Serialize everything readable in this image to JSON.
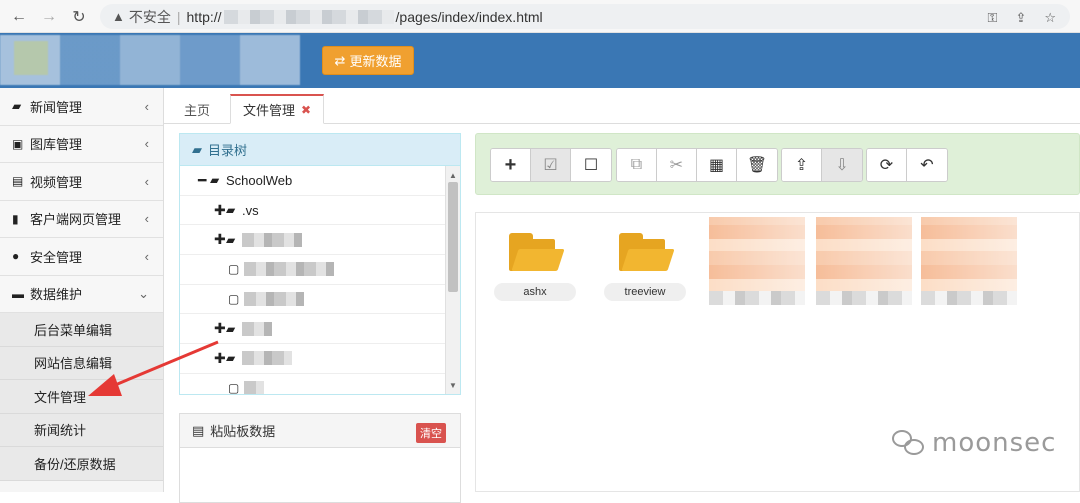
{
  "browser": {
    "back_icon": "←",
    "forward_icon": "→",
    "reload_icon": "↻",
    "security_label": "不安全",
    "url_prefix": "http://",
    "url_suffix": "/pages/index/index.html"
  },
  "header": {
    "update_button_label": "更新数据"
  },
  "sidebar": {
    "items": [
      {
        "label": "新闻管理",
        "icon": "folder-open-icon"
      },
      {
        "label": "图库管理",
        "icon": "picture-icon"
      },
      {
        "label": "视频管理",
        "icon": "film-icon"
      },
      {
        "label": "客户端网页管理",
        "icon": "file-icon"
      },
      {
        "label": "安全管理",
        "icon": "user-icon"
      },
      {
        "label": "数据维护",
        "icon": "hdd-icon"
      }
    ],
    "subitems": [
      "后台菜单编辑",
      "网站信息编辑",
      "文件管理",
      "新闻统计",
      "备份/还原数据"
    ]
  },
  "tabs": [
    {
      "label": "主页"
    },
    {
      "label": "文件管理"
    }
  ],
  "tree": {
    "title": "目录树",
    "root": "SchoolWeb",
    "node_vs": ".vs"
  },
  "clipboard": {
    "title": "粘贴板数据",
    "clear_label": "清空"
  },
  "files": [
    {
      "name": "ashx",
      "type": "folder"
    },
    {
      "name": "treeview",
      "type": "folder"
    }
  ],
  "watermark": {
    "text": "moonsec"
  },
  "colors": {
    "header": "#3a77b4",
    "update_button": "#f0a030",
    "folder": "#e6a521",
    "toolbar_bg": "#dff0d8",
    "tree_head": "#d9edf7",
    "clear_button": "#d9534f",
    "annotation_arrow": "#e53935"
  }
}
